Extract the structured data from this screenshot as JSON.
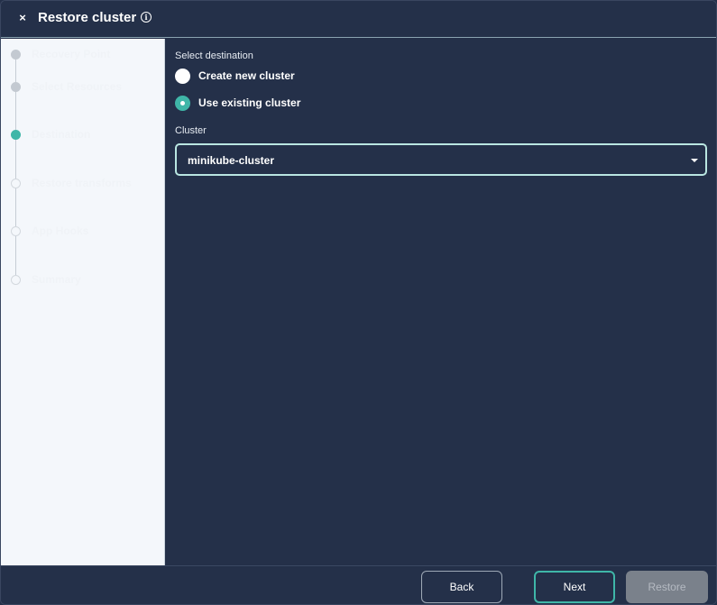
{
  "dialog": {
    "title": "Restore cluster",
    "close_icon": "×",
    "info_icon": "i"
  },
  "sidebar": {
    "steps": [
      {
        "label": "Recovery Point",
        "state": "done"
      },
      {
        "label": "Select Resources",
        "state": "done"
      },
      {
        "label": "Destination",
        "state": "active"
      },
      {
        "label": "Restore transforms",
        "state": "todo"
      },
      {
        "label": "App Hooks",
        "state": "todo"
      },
      {
        "label": "Summary",
        "state": "todo"
      }
    ]
  },
  "main": {
    "section_label": "Select destination",
    "options": [
      {
        "label": "Create new cluster",
        "checked": false
      },
      {
        "label": "Use existing cluster",
        "checked": true
      }
    ],
    "cluster_label": "Cluster",
    "cluster_value": "minikube-cluster"
  },
  "footer": {
    "back_label": "Back",
    "next_label": "Next",
    "restore_label": "Restore"
  },
  "colors": {
    "background": "#243049",
    "accent": "#3fb6a8",
    "sidebar": "#f4f7fb"
  }
}
